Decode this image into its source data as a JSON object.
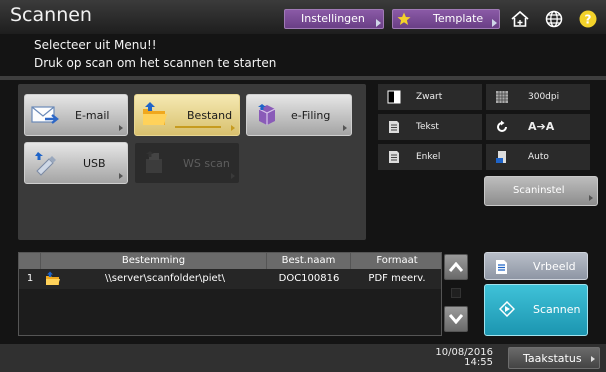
{
  "titlebar": {
    "title": "Scannen",
    "settings_label": "Instellingen",
    "template_label": "Template",
    "icons": [
      "star-icon",
      "home-icon",
      "globe-icon",
      "help-icon"
    ]
  },
  "message": {
    "line1": "Selecteer uit Menu!!",
    "line2": "Druk op scan om het scannen te starten"
  },
  "destinations": [
    {
      "label": "E-mail",
      "icon": "email-icon",
      "state": "normal"
    },
    {
      "label": "Bestand",
      "icon": "folder-icon",
      "state": "selected"
    },
    {
      "label": "e-Filing",
      "icon": "efiling-box-icon",
      "state": "normal"
    },
    {
      "label": "USB",
      "icon": "usb-icon",
      "state": "normal"
    },
    {
      "label": "WS scan",
      "icon": "ws-scan-icon",
      "state": "disabled"
    }
  ],
  "settings": {
    "color": "Zwart",
    "resolution": "300dpi",
    "mode": "Tekst",
    "rotation": "A➔A",
    "sides": "Enkel",
    "size": "Auto",
    "scaninstel": "Scaninstel"
  },
  "table": {
    "headers": [
      "Bestemming",
      "Best.naam",
      "Formaat"
    ],
    "rows": [
      {
        "index": "1",
        "destination": "\\\\server\\scanfolder\\piet\\",
        "filename": "DOC100816",
        "format": "PDF meerv."
      }
    ]
  },
  "actions": {
    "preview": "Vrbeeld",
    "scan": "Scannen"
  },
  "status": {
    "date": "10/08/2016",
    "time": "14:55",
    "job_status": "Taakstatus"
  },
  "colors": {
    "accent_purple": "#7a4d97",
    "scan_cyan": "#2aaac4",
    "selected_gold": "#d8c06e"
  }
}
